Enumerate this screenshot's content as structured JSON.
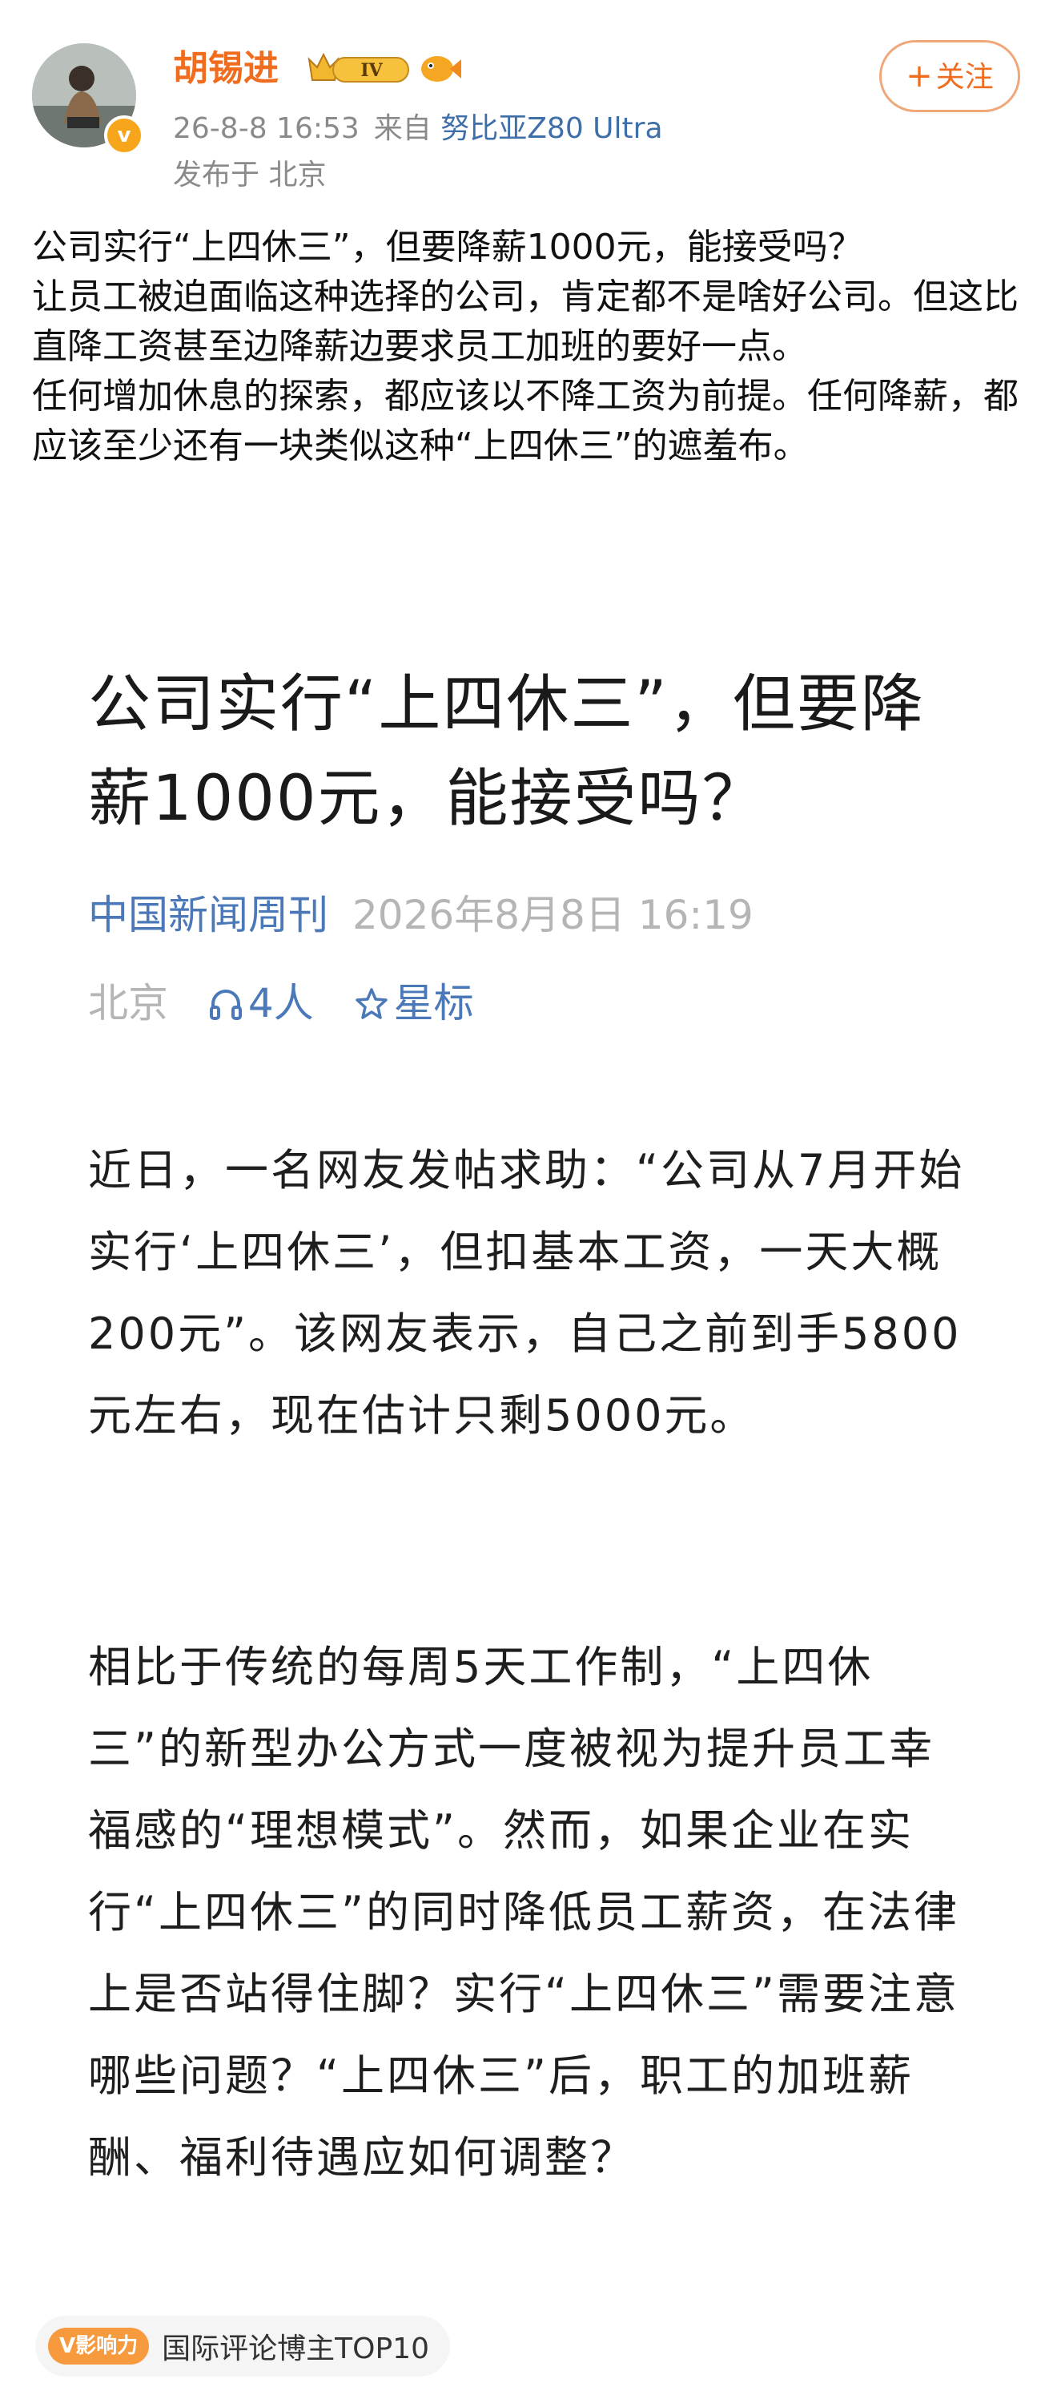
{
  "author": {
    "name": "胡锡进",
    "avatar_badge": "v",
    "vip_level": "IV",
    "timestamp": "26-8-8 16:53",
    "source_prefix": "来自",
    "device": "努比亚Z80 Ultra",
    "location": "发布于 北京"
  },
  "follow_button": {
    "plus": "+",
    "label": "关注"
  },
  "post": {
    "paragraphs": [
      "公司实行“上四休三”，但要降薪1000元，能接受吗？",
      "让员工被迫面临这种选择的公司，肯定都不是啥好公司。但这比直降工资甚至边降薪边要求员工加班的要好一点。",
      "任何增加休息的探索，都应该以不降工资为前提。任何降薪，都应该至少还有一块类似这种“上四休三”的遮羞布。"
    ]
  },
  "article": {
    "title": "公司实行“上四休三”，但要降薪1000元，能接受吗？",
    "source": "中国新闻周刊",
    "date": "2026年8月8日 16:19",
    "location": "北京",
    "listeners": "4人",
    "star_label": "星标",
    "paragraphs": [
      "近日，一名网友发帖求助：“公司从7月开始实行‘上四休三’，但扣基本工资，一天大概200元”。该网友表示，自己之前到手5800元左右，现在估计只剩5000元。",
      "相比于传统的每周5天工作制，“上四休三”的新型办公方式一度被视为提升员工幸福感的“理想模式”。然而，如果企业在实行“上四休三”的同时降低员工薪资，在法律上是否站得住脚？实行“上四休三”需要注意哪些问题？“上四休三”后，职工的加班薪酬、福利待遇应如何调整？"
    ]
  },
  "influence": {
    "logo": "V影响力",
    "label": "国际评论博主TOP10"
  },
  "colors": {
    "name_orange": "#f06c1e",
    "link_blue": "#4a78b8",
    "meta_gray": "#8a8a8a"
  }
}
